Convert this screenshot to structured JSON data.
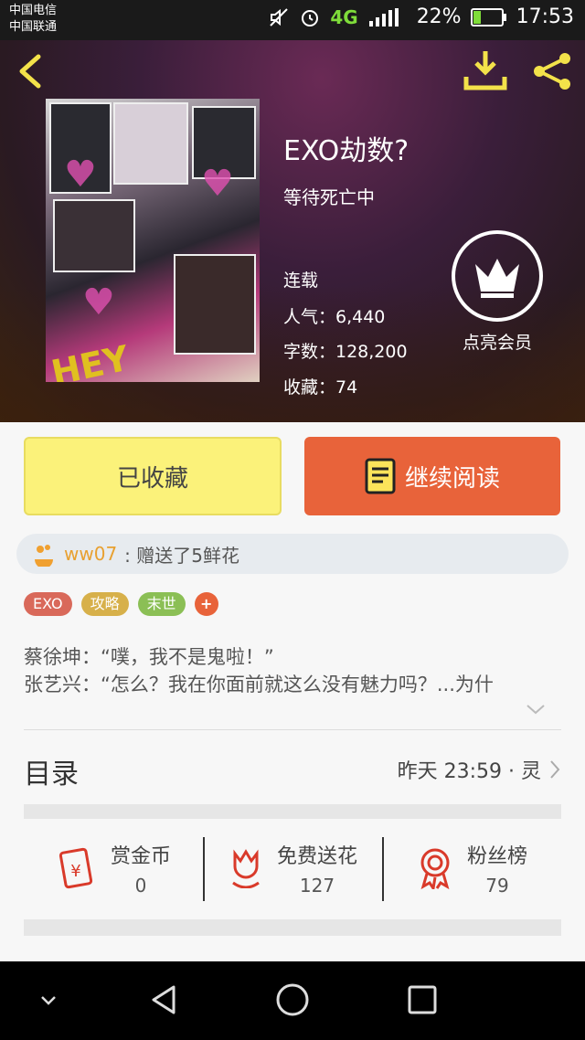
{
  "status": {
    "carrier1": "中国电信",
    "carrier2": "中国联通",
    "network": "4G",
    "battery": "22%",
    "time": "17:53"
  },
  "book": {
    "title": "EXO劫数?",
    "author": "等待死亡中",
    "status": "连载",
    "popularity": "人气：6,440",
    "words": "字数：128,200",
    "favorites": "收藏：74",
    "cover_text": "HEY"
  },
  "vip": {
    "label": "点亮会员"
  },
  "actions": {
    "favorited_label": "已收藏",
    "continue_label": "继续阅读"
  },
  "gift": {
    "user": "ww07",
    "message": ": 赠送了5鲜花"
  },
  "tags": [
    {
      "label": "EXO",
      "color": "#d9695a"
    },
    {
      "label": "攻略",
      "color": "#d7b04a"
    },
    {
      "label": "末世",
      "color": "#8bbf55"
    },
    {
      "label": "+",
      "color": "#e8633a"
    }
  ],
  "description": {
    "line1": "蔡徐坤：“噗，我不是鬼啦！”",
    "line2": "张艺兴：“怎么？我在你面前就这么没有魅力吗？...为什"
  },
  "toc": {
    "label": "目录",
    "update": "昨天 23:59 · 灵"
  },
  "stats": [
    {
      "label": "赏金币",
      "value": "0",
      "icon": "red-envelope-icon"
    },
    {
      "label": "免费送花",
      "value": "127",
      "icon": "flower-icon"
    },
    {
      "label": "粉丝榜",
      "value": "79",
      "icon": "medal-icon"
    }
  ],
  "colors": {
    "accent_orange": "#e8633a",
    "accent_yellow": "#fbf27a",
    "icon_red": "#d93a2a",
    "nav_yellow": "#f3e24a"
  }
}
